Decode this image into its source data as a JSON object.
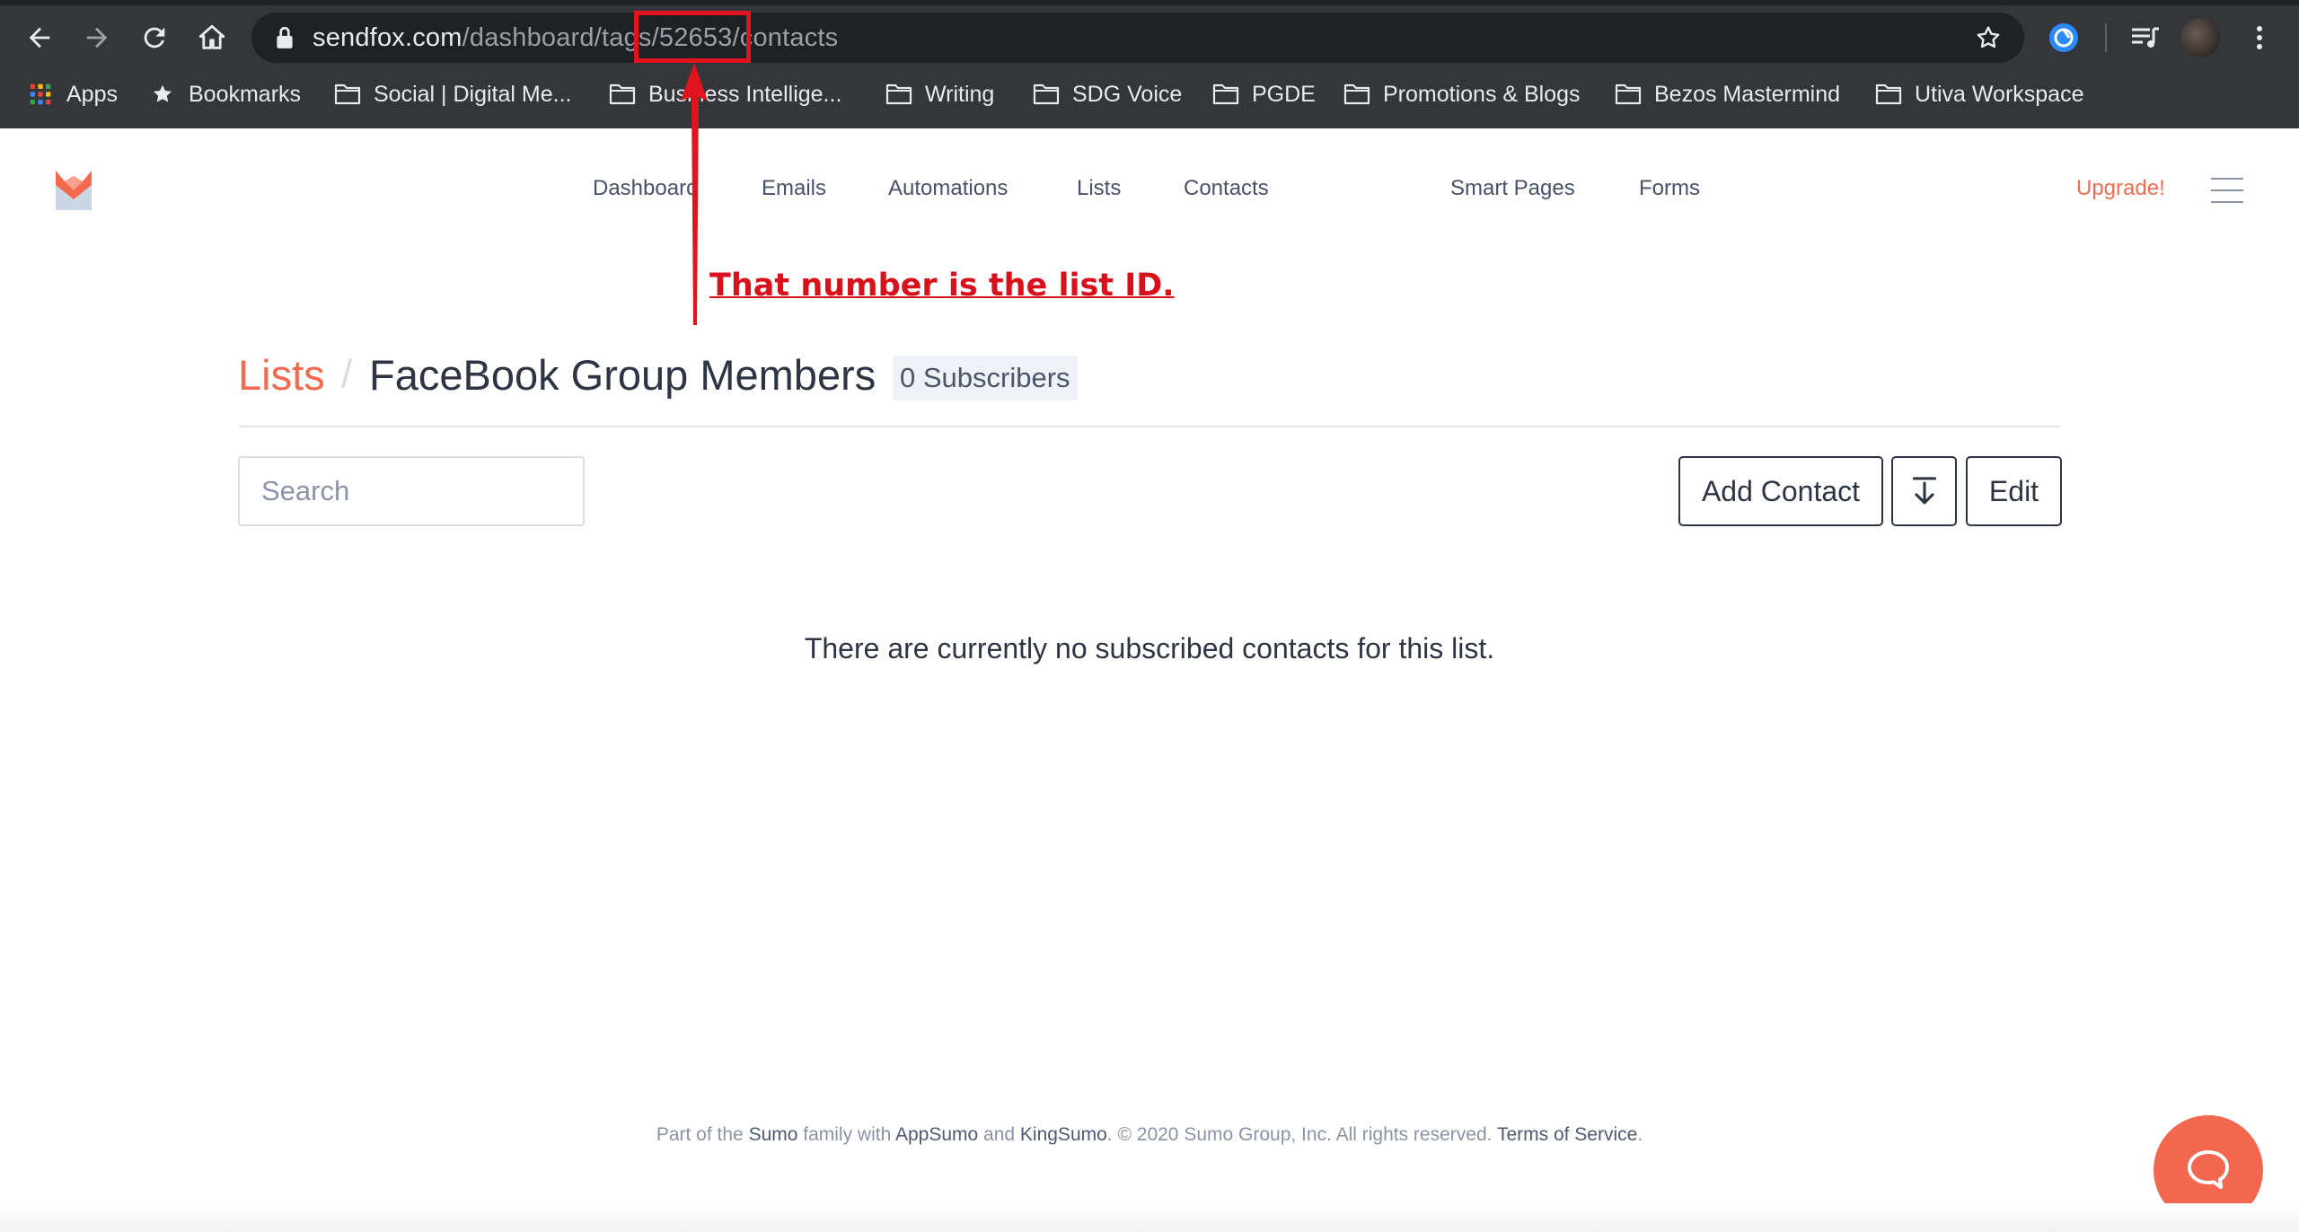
{
  "browser": {
    "url_host": "sendfox.com",
    "url_path": "/dashboard/tags/52653/contacts",
    "bookmarks": [
      {
        "label": "Apps",
        "icon": "apps-grid-icon"
      },
      {
        "label": "Bookmarks",
        "icon": "star-icon"
      },
      {
        "label": "Social | Digital Me...",
        "icon": "folder-icon"
      },
      {
        "label": "Business Intellige...",
        "icon": "folder-icon"
      },
      {
        "label": "Writing",
        "icon": "folder-icon"
      },
      {
        "label": "SDG Voice",
        "icon": "folder-icon"
      },
      {
        "label": "PGDE",
        "icon": "folder-icon"
      },
      {
        "label": "Promotions & Blogs",
        "icon": "folder-icon"
      },
      {
        "label": "Bezos Mastermind",
        "icon": "folder-icon"
      },
      {
        "label": "Utiva Workspace",
        "icon": "folder-icon"
      }
    ]
  },
  "nav": {
    "items": [
      "Dashboard",
      "Emails",
      "Automations",
      "Lists",
      "Contacts",
      "Smart Pages",
      "Forms"
    ],
    "upgrade": "Upgrade!"
  },
  "annotation": {
    "text": "That number is the list ID.",
    "color": "#d8111b"
  },
  "page": {
    "breadcrumb_root": "Lists",
    "breadcrumb_sep": "/",
    "title": "FaceBook Group Members",
    "subscribers_badge": "0 Subscribers",
    "search_placeholder": "Search",
    "add_contact_label": "Add Contact",
    "edit_label": "Edit",
    "empty_message": "There are currently no subscribed contacts for this list."
  },
  "footer": {
    "t1": "Part of the ",
    "sumo": "Sumo",
    "t2": " family with ",
    "appsumo": "AppSumo",
    "t3": " and ",
    "kingsumo": "KingSumo",
    "t4": ". © 2020 Sumo Group, Inc. All rights reserved. ",
    "terms": "Terms of Service",
    "t5": "."
  },
  "colors": {
    "brand_accent": "#f36a4f",
    "text_primary": "#2d3545",
    "chrome_bg": "#35363a"
  }
}
